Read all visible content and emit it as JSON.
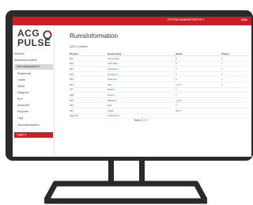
{
  "app": {
    "logo_line1": "ACG",
    "logo_line2": "PULSE",
    "page_title": "RumsInformation",
    "subtitle": "ACG Lokaler",
    "user": "SYSTEM ADMINISTRATOR ▾",
    "topbar_link": "Hjälp",
    "brand_color": "#ce1d26"
  },
  "sidebar": {
    "items": [
      {
        "label": "Startsida",
        "state": "normal"
      },
      {
        "label": "Administrera system",
        "state": "normal"
      },
      {
        "label": "Informationssystem ▾",
        "state": "active"
      },
      {
        "label": "Registrering",
        "state": "normal"
      },
      {
        "label": "Lokaler",
        "state": "normal"
      },
      {
        "label": "Status",
        "state": "normal"
      },
      {
        "label": "Kategorier",
        "state": "normal"
      },
      {
        "label": "Rum",
        "state": "normal"
      },
      {
        "label": "Användare",
        "state": "normal"
      },
      {
        "label": "Rapporter",
        "state": "normal"
      },
      {
        "label": "Logg",
        "state": "normal"
      },
      {
        "label": "Informationssystem",
        "state": "normal"
      },
      {
        "label": "Logga ut",
        "state": "danger"
      }
    ]
  },
  "table": {
    "columns": [
      "Rumsnr",
      "Beskrivning",
      "Status",
      "Platser"
    ],
    "rows": [
      [
        "001",
        "Stora salen",
        "5",
        "1"
      ],
      [
        "002",
        "Lilla salen",
        "5",
        "1"
      ],
      [
        "003",
        "Konferens",
        "5",
        "1"
      ],
      [
        "004",
        "Grupprum",
        "5",
        "1"
      ],
      [
        "005",
        "Pausrum",
        "5",
        "1"
      ],
      [
        "006",
        "Lab",
        "12:23",
        "1"
      ],
      [
        "007",
        "Studio",
        "1",
        ""
      ],
      [
        "008",
        "Kontor",
        "7",
        ""
      ],
      [
        "009",
        "Bibliotek",
        "4:125",
        ""
      ],
      [
        "010",
        "Kök",
        "5",
        ""
      ],
      [
        "011",
        "Foajé",
        "48:17",
        ""
      ],
      [
        "Lägg till",
        "Anteckning",
        "",
        ""
      ]
    ]
  },
  "pager": {
    "prefix": "Sida:",
    "current": "1",
    "others": "2  3  ›"
  }
}
